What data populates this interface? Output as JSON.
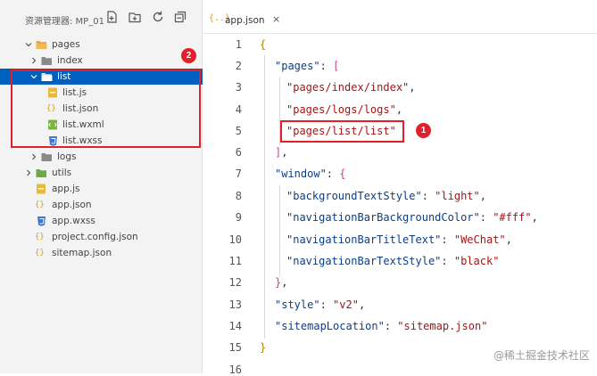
{
  "explorer": {
    "title": "资源管理器: MP_01",
    "header_icons": [
      "new-file-icon",
      "new-folder-icon",
      "refresh-icon",
      "collapse-all-icon"
    ],
    "items": [
      {
        "label": "pages",
        "icon": "folder-open-icon",
        "expanded": true
      },
      {
        "label": "index",
        "icon": "folder-icon",
        "expanded": false
      },
      {
        "label": "list",
        "icon": "folder-open-icon",
        "expanded": true,
        "selected": true
      },
      {
        "label": "list.js",
        "icon": "js-file-icon"
      },
      {
        "label": "list.json",
        "icon": "json-file-icon"
      },
      {
        "label": "list.wxml",
        "icon": "wxml-file-icon"
      },
      {
        "label": "list.wxss",
        "icon": "wxss-file-icon"
      },
      {
        "label": "logs",
        "icon": "folder-icon",
        "expanded": false
      },
      {
        "label": "utils",
        "icon": "folder-icon",
        "expanded": false
      },
      {
        "label": "app.js",
        "icon": "js-file-icon"
      },
      {
        "label": "app.json",
        "icon": "json-file-icon"
      },
      {
        "label": "app.wxss",
        "icon": "wxss-file-icon"
      },
      {
        "label": "project.config.json",
        "icon": "json-file-icon"
      },
      {
        "label": "sitemap.json",
        "icon": "json-file-icon"
      }
    ]
  },
  "editor": {
    "tab": {
      "label": "app.json",
      "icon": "{..}",
      "close": "×"
    },
    "line_numbers": [
      "1",
      "2",
      "3",
      "4",
      "5",
      "6",
      "7",
      "8",
      "9",
      "10",
      "11",
      "12",
      "13",
      "14",
      "15",
      "16"
    ],
    "code": {
      "l1_open": "{",
      "l2_key": "\"pages\"",
      "l2_colon": ": ",
      "l2_bracket": "[",
      "l3_str": "\"pages/index/index\"",
      "l3_comma": ",",
      "l4_str": "\"pages/logs/logs\"",
      "l4_comma": ",",
      "l5_str": "\"pages/list/list\"",
      "l6_bracket": "]",
      "l6_comma": ",",
      "l7_key": "\"window\"",
      "l7_colon": ": ",
      "l7_brace": "{",
      "l8_key": "\"backgroundTextStyle\"",
      "l8_colon": ": ",
      "l8_val": "\"light\"",
      "l8_comma": ",",
      "l9_key": "\"navigationBarBackgroundColor\"",
      "l9_colon": ": ",
      "l9_val": "\"#fff\"",
      "l9_comma": ",",
      "l10_key": "\"navigationBarTitleText\"",
      "l10_colon": ": ",
      "l10_val": "\"WeChat\"",
      "l10_comma": ",",
      "l11_key": "\"navigationBarTextStyle\"",
      "l11_colon": ": ",
      "l11_val": "\"black\"",
      "l12_brace": "}",
      "l12_comma": ",",
      "l13_key": "\"style\"",
      "l13_colon": ": ",
      "l13_val": "\"v2\"",
      "l13_comma": ",",
      "l14_key": "\"sitemapLocation\"",
      "l14_colon": ": ",
      "l14_val": "\"sitemap.json\"",
      "l15_close": "}"
    }
  },
  "annotations": {
    "badge1": "1",
    "badge2": "2"
  },
  "watermark": "@稀土掘金技术社区",
  "colors": {
    "accent": "#e0202a",
    "selection": "#0060c0",
    "folder": "#e8a33d"
  }
}
